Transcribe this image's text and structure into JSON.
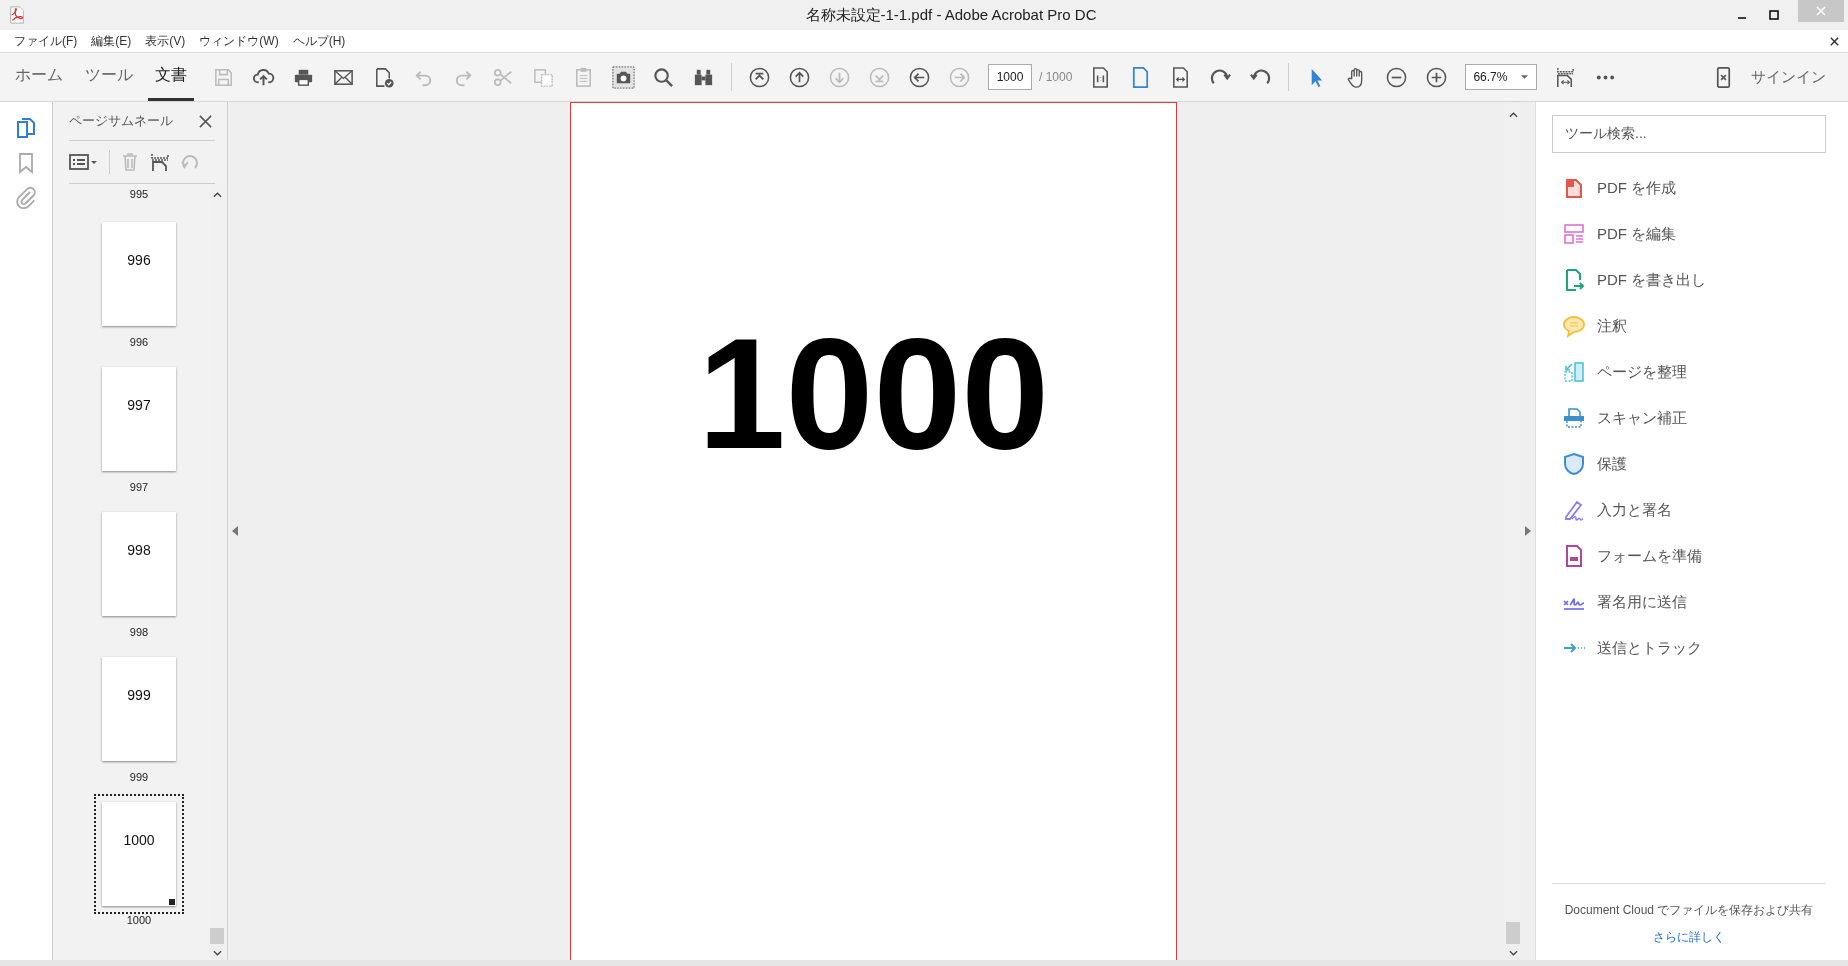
{
  "window": {
    "title": "名称未設定-1-1.pdf - Adobe Acrobat Pro DC"
  },
  "menu": [
    "ファイル(F)",
    "編集(E)",
    "表示(V)",
    "ウィンドウ(W)",
    "ヘルプ(H)"
  ],
  "tabs": [
    {
      "label": "ホーム",
      "selected": false
    },
    {
      "label": "ツール",
      "selected": false
    },
    {
      "label": "文書",
      "selected": true
    }
  ],
  "toolbar": [
    [
      {
        "kind": "save",
        "disabled": true,
        "on": false
      },
      {
        "kind": "upload",
        "disabled": false,
        "on": false
      },
      {
        "kind": "print",
        "disabled": false,
        "on": false
      },
      {
        "kind": "mail",
        "disabled": false,
        "on": false
      },
      {
        "kind": "docsign",
        "disabled": false,
        "on": false
      },
      {
        "kind": "undo",
        "disabled": true,
        "on": false
      },
      {
        "kind": "redo",
        "disabled": true,
        "on": false
      },
      {
        "kind": "cut",
        "disabled": true,
        "on": false
      },
      {
        "kind": "copy",
        "disabled": true,
        "on": false
      },
      {
        "kind": "paste",
        "disabled": true,
        "on": false
      },
      {
        "kind": "snapshot",
        "disabled": false,
        "on": true
      },
      {
        "kind": "search",
        "disabled": false,
        "on": false
      },
      {
        "kind": "binoculars",
        "disabled": false,
        "on": false
      }
    ],
    [
      {
        "kind": "first",
        "disabled": false,
        "on": false
      },
      {
        "kind": "up",
        "disabled": false,
        "on": false
      },
      {
        "kind": "down",
        "disabled": true,
        "on": false
      },
      {
        "kind": "last",
        "disabled": true,
        "on": false
      },
      {
        "kind": "back",
        "disabled": false,
        "on": false
      },
      {
        "kind": "forward",
        "disabled": true,
        "on": false
      },
      {
        "kind": "page_field",
        "value": "1000",
        "total": "/ 1000"
      },
      {
        "kind": "actual",
        "disabled": false,
        "on": false
      },
      {
        "kind": "fitpage",
        "disabled": false,
        "on": true
      },
      {
        "kind": "fitwidth",
        "disabled": false,
        "on": false
      },
      {
        "kind": "rotcw",
        "disabled": false,
        "on": false
      },
      {
        "kind": "rotccw",
        "disabled": false,
        "on": false
      }
    ],
    [
      {
        "kind": "select",
        "disabled": false,
        "on": true
      },
      {
        "kind": "hand",
        "disabled": false,
        "on": false
      },
      {
        "kind": "zoomout",
        "disabled": false,
        "on": false
      },
      {
        "kind": "zoomin",
        "disabled": false,
        "on": false
      },
      {
        "kind": "zoom_field",
        "value": "66.7%"
      },
      {
        "kind": "scrollmode",
        "disabled": false,
        "on": false
      },
      {
        "kind": "more",
        "disabled": false,
        "on": false
      }
    ]
  ],
  "sign_in": "サインイン",
  "rail": [
    {
      "kind": "pages",
      "selected": true
    },
    {
      "kind": "bookmark",
      "selected": false
    },
    {
      "kind": "attach",
      "selected": false
    }
  ],
  "thumbnail_panel": {
    "title": "ページサムネール",
    "thumbnails": [
      {
        "caption": "995",
        "selected": false
      },
      {
        "page_text": "996",
        "caption": "996",
        "selected": false
      },
      {
        "page_text": "997",
        "caption": "997",
        "selected": false
      },
      {
        "page_text": "998",
        "caption": "998",
        "selected": false
      },
      {
        "page_text": "999",
        "caption": "999",
        "selected": false
      },
      {
        "page_text": "1000",
        "caption": "1000",
        "selected": true
      }
    ]
  },
  "document": {
    "page_text": "1000"
  },
  "tools_panel": {
    "search": {
      "placeholder": "ツール検索..."
    },
    "tools": [
      {
        "kind": "create",
        "label": "PDF を作成"
      },
      {
        "kind": "edit",
        "label": "PDF を編集"
      },
      {
        "kind": "export",
        "label": "PDF を書き出し"
      },
      {
        "kind": "comment",
        "label": "注釈"
      },
      {
        "kind": "organize",
        "label": "ページを整理"
      },
      {
        "kind": "scan",
        "label": "スキャン補正"
      },
      {
        "kind": "protect",
        "label": "保護"
      },
      {
        "kind": "fillsign",
        "label": "入力と署名"
      },
      {
        "kind": "form",
        "label": "フォームを準備"
      },
      {
        "kind": "sendsign",
        "label": "署名用に送信"
      },
      {
        "kind": "track",
        "label": "送信とトラック"
      }
    ],
    "footer": "Document Cloud でファイルを保存および共有",
    "link": "さらに詳しく"
  }
}
